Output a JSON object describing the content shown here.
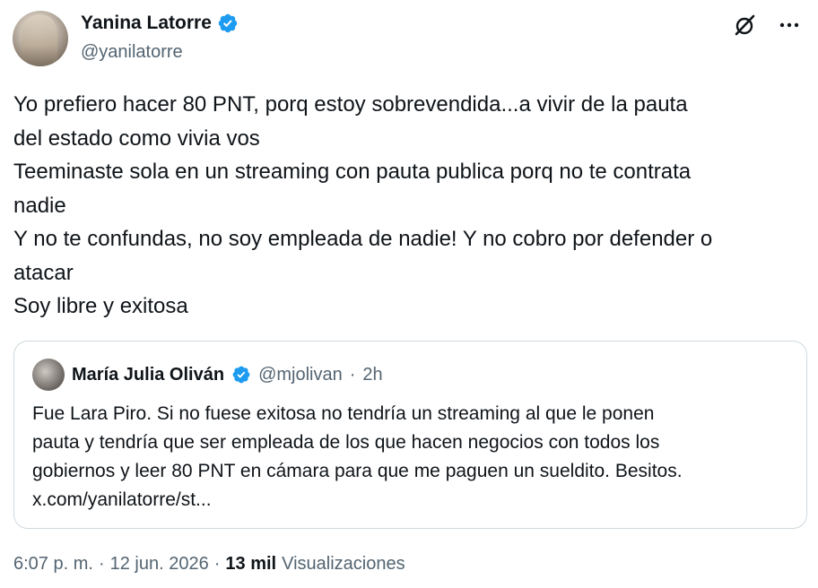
{
  "author": {
    "name": "Yanina Latorre",
    "handle": "@yanilatorre"
  },
  "icons": {
    "verified": "verified-badge-icon",
    "grok": "grok-icon",
    "more": "more-icon",
    "verified_color": "#1d9bf0"
  },
  "tweet": {
    "lines": [
      "Yo prefiero hacer 80 PNT, porq estoy sobrevendida...a vivir de la pauta",
      "del estado como vivia vos",
      "Teeminaste sola en un streaming con pauta publica porq no te contrata",
      "nadie",
      "Y no te confundas, no soy empleada de nadie! Y no cobro por defender o",
      "atacar",
      "Soy libre y exitosa"
    ]
  },
  "quote": {
    "name": "María Julia Oliván",
    "handle": "@mjolivan",
    "separator": "·",
    "time": "2h",
    "lines": [
      "Fue Lara Piro. Si no fuese exitosa no tendría un streaming al que le ponen",
      "pauta y tendría que ser empleada de los que hacen negocios con todos los",
      "gobiernos y leer 80 PNT en cámara para que me paguen un sueldito. Besitos.",
      "x.com/yanilatorre/st..."
    ]
  },
  "meta": {
    "time": "6:07 p. m.",
    "separator1": "·",
    "date": "12 jun. 2026",
    "separator2": "·",
    "views_count": "13 mil",
    "views_label": "Visualizaciones"
  }
}
